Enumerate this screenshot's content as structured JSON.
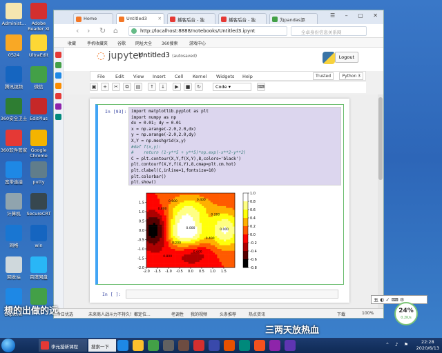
{
  "desktop": {
    "icons": [
      {
        "label": "Administ..."
      },
      {
        "label": "Adobe Reader XI"
      },
      {
        "label": "0524"
      },
      {
        "label": "UltraEdit"
      },
      {
        "label": "腾讯视频"
      },
      {
        "label": "微信"
      },
      {
        "label": "360安全卫士"
      },
      {
        "label": "EditPlus"
      },
      {
        "label": "360软件管家"
      },
      {
        "label": "Google Chrome"
      },
      {
        "label": "宽带连接"
      },
      {
        "label": "putty"
      },
      {
        "label": "计算机"
      },
      {
        "label": "SecureCRT"
      },
      {
        "label": "网络"
      },
      {
        "label": "win"
      },
      {
        "label": "回收站"
      },
      {
        "label": "百度网盘"
      },
      {
        "label": "Internet Explorer"
      },
      {
        "label": "360"
      }
    ],
    "caption_left": "想的出做的远",
    "caption_right": "三两天放热血"
  },
  "browser": {
    "tabs": [
      {
        "label": "Home"
      },
      {
        "label": "Untitled3"
      },
      {
        "label": "播客后台 - 独"
      },
      {
        "label": "播客后台 - 独"
      },
      {
        "label": "为pandas添"
      }
    ],
    "url": "http://localhost:8888/notebooks/Untitled3.ipynt",
    "search_placeholder": "全卓身份信息关系网",
    "bookmarks": [
      "收藏",
      "手机收藏夹",
      "谷歌",
      "网址大全",
      "360搜索",
      "游戏中心"
    ],
    "status": {
      "left": "今日优选",
      "news": "未来商人战斗力不持久！都定位...",
      "items": [
        "老调性",
        "我的视频",
        "头条推荐",
        "热点资讯",
        "下载"
      ],
      "zoom": "100%"
    }
  },
  "jupyter": {
    "logo": "jupyter",
    "notebook_title": "Untitled3",
    "autosave": "(autosaved)",
    "logout": "Logout",
    "menu": [
      "File",
      "Edit",
      "View",
      "Insert",
      "Cell",
      "Kernel",
      "Widgets",
      "Help"
    ],
    "trusted": "Trusted",
    "kernel": "Python 3",
    "cell_type": "Code",
    "toolbar_icons": [
      "save-icon",
      "plus-icon",
      "cut-icon",
      "copy-icon",
      "paste-icon",
      "arrow-up-icon",
      "arrow-down-icon",
      "run-icon",
      "stop-icon",
      "restart-icon"
    ],
    "cell1": {
      "prompt": "In  [93]:",
      "code": [
        "import matplotlib.pyplot as plt",
        "import numpy as np",
        "dx = 0.01; dy = 0.01",
        "x = np.arange(-2.0,2.0,dx)",
        "y = np.arange(-2.0,2.0,dy)",
        "X,Y = np.meshgrid(x,y)",
        "#def f(x,y):",
        "#    return (1-y**5 + y**5)*np.exp(-x**2-y**2)",
        "C = plt.contour(X,Y,f(X,Y),8,colors='black')",
        "plt.contourf(X,Y,f(X,Y),8,cmap=plt.cm.hot)",
        "plt.clabel(C,inline=1,fontsize=10)",
        "plt.colorbar()",
        "plt.show()"
      ]
    },
    "cell2": {
      "prompt": "In  [ ]:"
    }
  },
  "chart_data": {
    "type": "heatmap",
    "xlim": [
      -2.0,
      2.0
    ],
    "ylim": [
      -2.0,
      2.0
    ],
    "x_ticks": [
      "-2.0",
      "-1.5",
      "-1.0",
      "-0.5",
      "0.0",
      "0.5",
      "1.0",
      "1.5"
    ],
    "y_ticks": [
      "-2.0",
      "-1.5",
      "-1.0",
      "-0.5",
      "0.0",
      "0.5",
      "1.0",
      "1.5"
    ],
    "colorbar_ticks": [
      "1.0",
      "0.8",
      "0.6",
      "0.4",
      "0.2",
      "0.0",
      "-0.2",
      "-0.4",
      "-0.6",
      "-0.8"
    ],
    "colorbar_range": [
      -0.8,
      1.0
    ],
    "contour_labels": [
      "0.800",
      "0.600",
      "0.400",
      "0.200",
      "0.000",
      "0.200",
      "0.400",
      "0.600",
      "0.800",
      "0.000"
    ],
    "grid": false
  },
  "taskbar": {
    "items": [
      {
        "label": "李元授新课程"
      },
      {
        "label": "搜索一下"
      }
    ],
    "time": "22:28",
    "date": "2020/6/13"
  },
  "ime": {
    "label": "五"
  },
  "network": {
    "percent": "24%",
    "speed": "0.2K/s"
  }
}
